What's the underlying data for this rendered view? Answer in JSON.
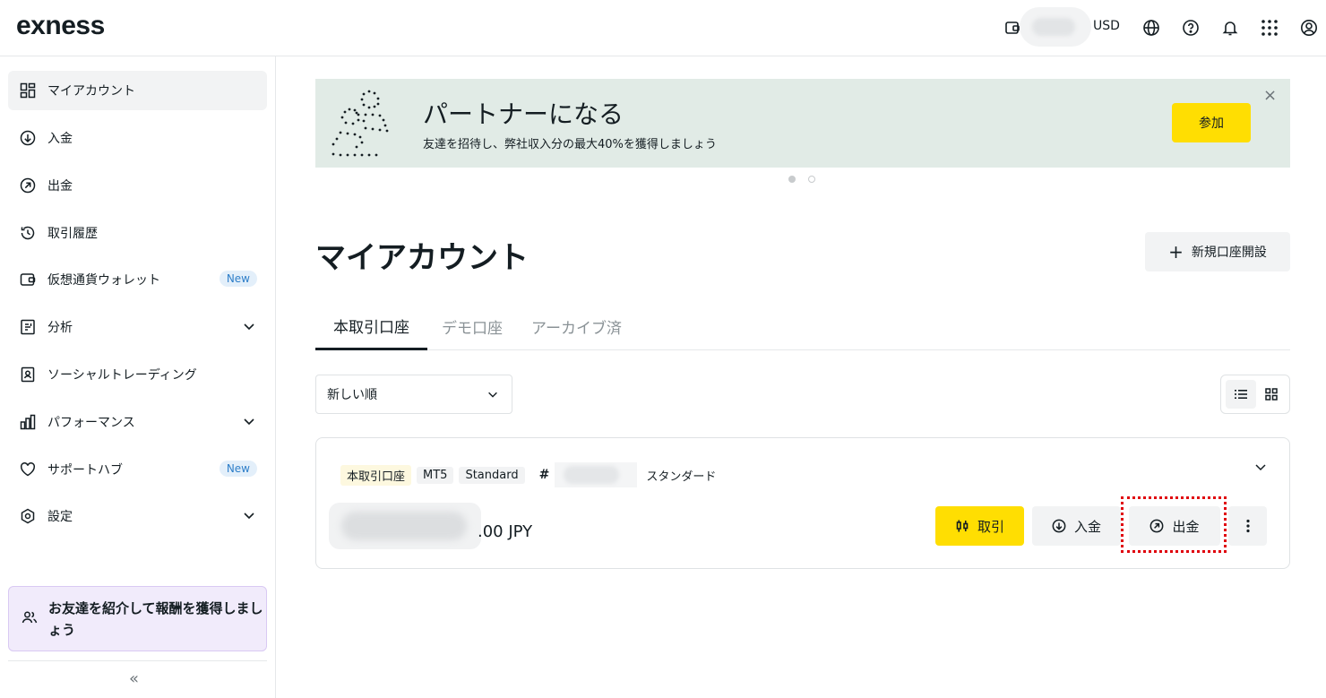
{
  "brand": {
    "logo_text": "exness"
  },
  "header": {
    "currency": "USD"
  },
  "sidebar": {
    "items": [
      {
        "label": "マイアカウント"
      },
      {
        "label": "入金"
      },
      {
        "label": "出金"
      },
      {
        "label": "取引履歴"
      },
      {
        "label": "仮想通貨ウォレット",
        "badge": "New"
      },
      {
        "label": "分析"
      },
      {
        "label": "ソーシャルトレーディング"
      },
      {
        "label": "パフォーマンス"
      },
      {
        "label": "サポートハブ",
        "badge": "New"
      },
      {
        "label": "設定"
      }
    ],
    "promo_text": "お友達を紹介して報酬を獲得しましょう",
    "collapse_label": "«"
  },
  "banner": {
    "title": "パートナーになる",
    "subtitle": "友達を招待し、弊社収入分の最大40%を獲得しましょう",
    "join_label": "参加",
    "close_label": "×"
  },
  "page": {
    "title": "マイアカウント",
    "new_account_label": "新規口座開設",
    "new_account_plus": "+"
  },
  "tabs": [
    {
      "label": "本取引口座"
    },
    {
      "label": "デモ口座"
    },
    {
      "label": "アーカイブ済"
    }
  ],
  "sort": {
    "value": "新しい順"
  },
  "account": {
    "tags": [
      "本取引口座",
      "MT5",
      "Standard"
    ],
    "hash": "#",
    "type_label": "スタンダード",
    "balance_suffix": ".00 JPY",
    "trade_label": "取引",
    "deposit_label": "入金",
    "withdraw_label": "出金"
  },
  "colors": {
    "accent_yellow": "#ffde02",
    "highlight_red": "#e0000b",
    "banner_bg": "#e1ebe6",
    "promo_bg": "#f1ebfb"
  }
}
